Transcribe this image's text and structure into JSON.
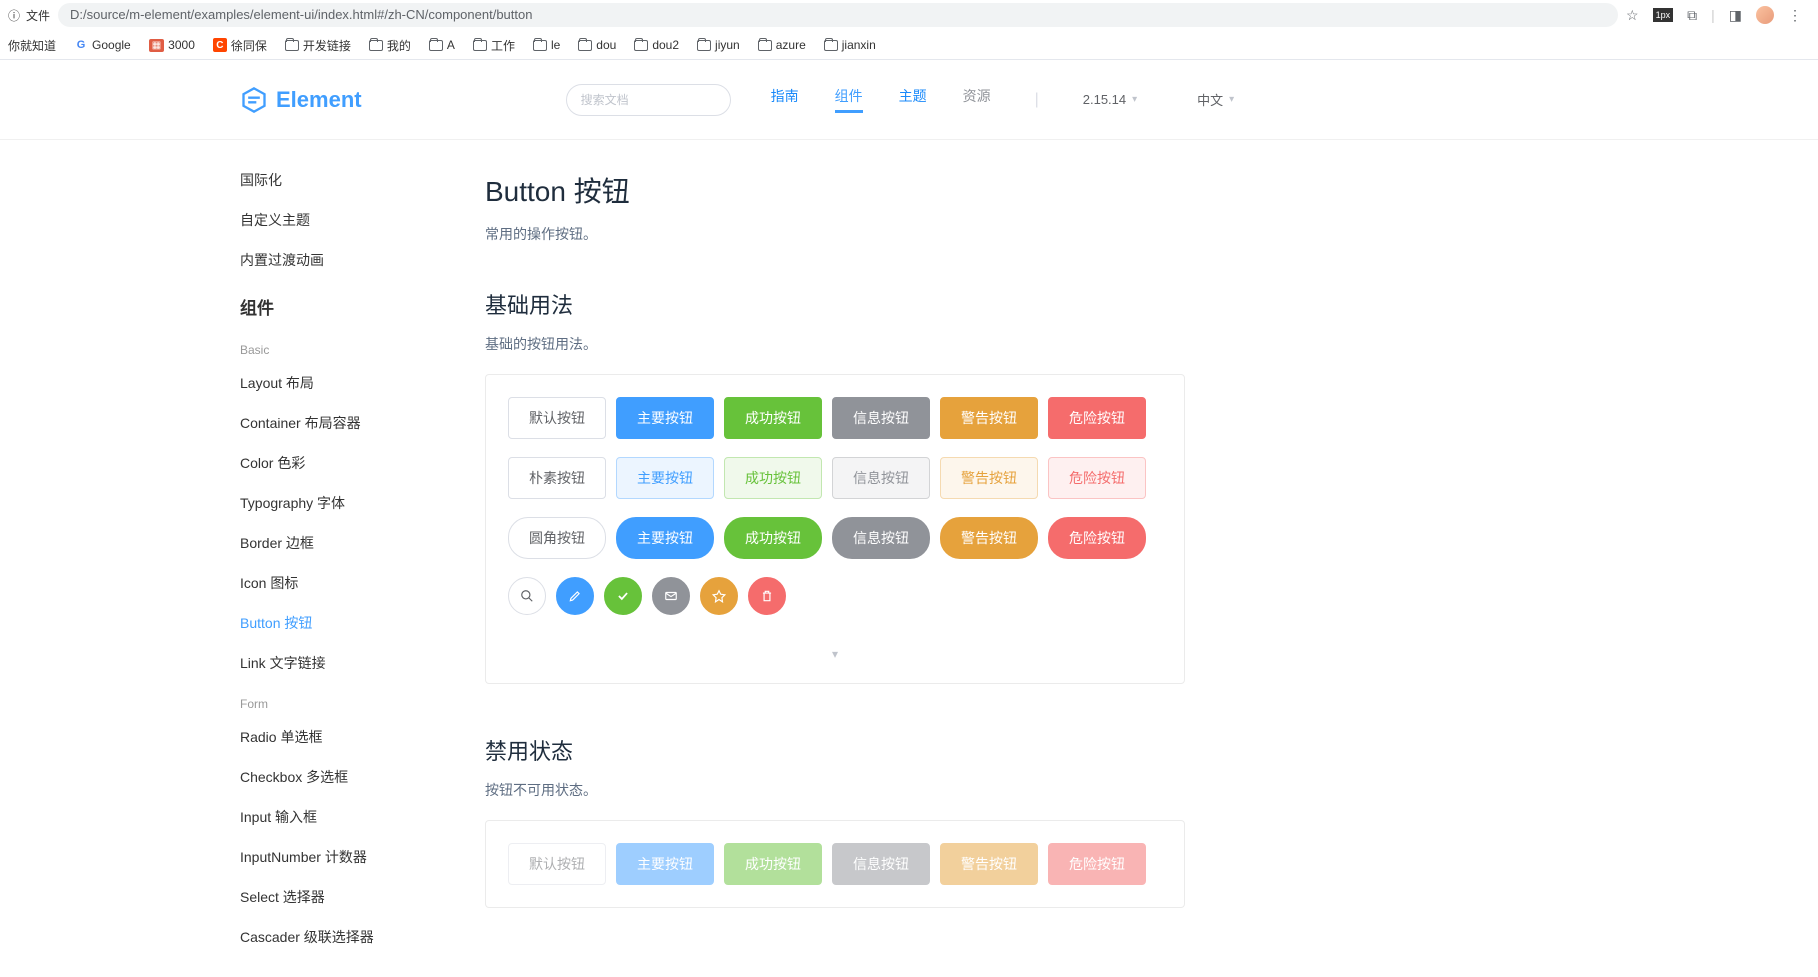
{
  "browser": {
    "file_label": "文件",
    "url": "D:/source/m-element/examples/element-ui/index.html#/zh-CN/component/button",
    "bookmarks": [
      "你就知道",
      "Google",
      "3000",
      "徐同保",
      "开发链接",
      "我的",
      "A",
      "工作",
      "le",
      "dou",
      "dou2",
      "jiyun",
      "azure",
      "jianxin"
    ]
  },
  "header": {
    "logo": "Element",
    "search_placeholder": "搜索文档",
    "nav": {
      "guide": "指南",
      "component": "组件",
      "theme": "主题",
      "resource": "资源"
    },
    "version": "2.15.14",
    "lang": "中文"
  },
  "sidebar": {
    "top": [
      "国际化",
      "自定义主题",
      "内置过渡动画"
    ],
    "heading_component": "组件",
    "group_basic": "Basic",
    "basic": [
      "Layout 布局",
      "Container 布局容器",
      "Color 色彩",
      "Typography 字体",
      "Border 边框",
      "Icon 图标",
      "Button 按钮",
      "Link 文字链接"
    ],
    "group_form": "Form",
    "form": [
      "Radio 单选框",
      "Checkbox 多选框",
      "Input 输入框",
      "InputNumber 计数器",
      "Select 选择器",
      "Cascader 级联选择器"
    ]
  },
  "content": {
    "title": "Button 按钮",
    "subtitle": "常用的操作按钮。",
    "section1": {
      "title": "基础用法",
      "desc": "基础的按钮用法。"
    },
    "buttons_row1": [
      "默认按钮",
      "主要按钮",
      "成功按钮",
      "信息按钮",
      "警告按钮",
      "危险按钮"
    ],
    "buttons_row2": [
      "朴素按钮",
      "主要按钮",
      "成功按钮",
      "信息按钮",
      "警告按钮",
      "危险按钮"
    ],
    "buttons_row3": [
      "圆角按钮",
      "主要按钮",
      "成功按钮",
      "信息按钮",
      "警告按钮",
      "危险按钮"
    ],
    "section2": {
      "title": "禁用状态",
      "desc": "按钮不可用状态。"
    },
    "buttons_disabled": [
      "默认按钮",
      "主要按钮",
      "成功按钮",
      "信息按钮",
      "警告按钮",
      "危险按钮"
    ]
  }
}
